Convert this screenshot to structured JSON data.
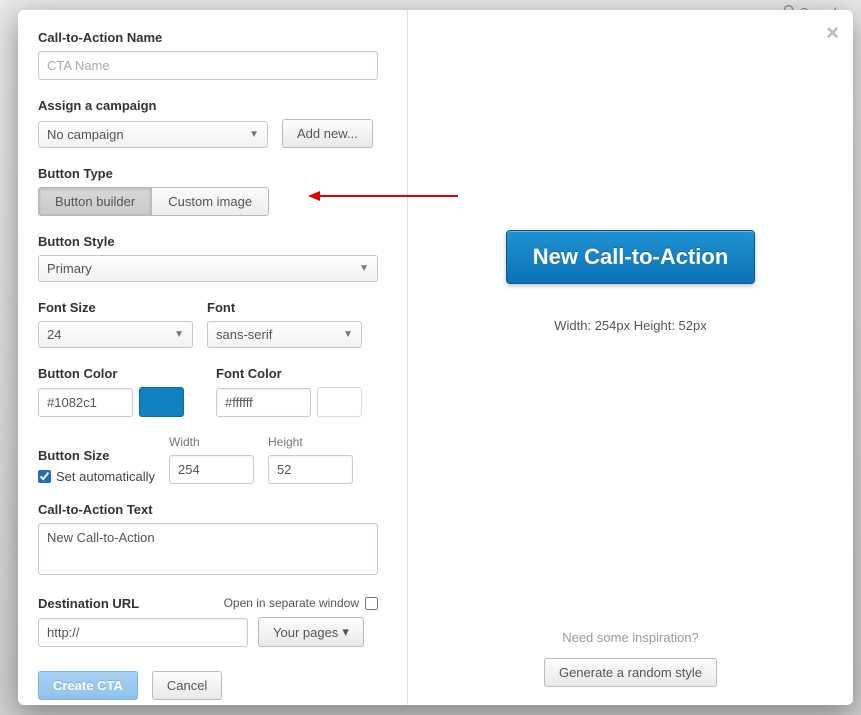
{
  "bg": {
    "search_placeholder": "Search"
  },
  "modal": {
    "cta_name_label": "Call-to-Action Name",
    "cta_name_placeholder": "CTA Name",
    "campaign_label": "Assign a campaign",
    "campaign_value": "No campaign",
    "add_new_label": "Add new...",
    "button_type_label": "Button Type",
    "seg_builder": "Button builder",
    "seg_custom": "Custom image",
    "button_style_label": "Button Style",
    "button_style_value": "Primary",
    "font_size_label": "Font Size",
    "font_size_value": "24",
    "font_label": "Font",
    "font_value": "sans-serif",
    "button_color_label": "Button Color",
    "button_color_value": "#1082c1",
    "button_color_hex": "#1082c1",
    "font_color_label": "Font Color",
    "font_color_value": "#ffffff",
    "font_color_hex": "#ffffff",
    "button_size_label": "Button Size",
    "set_auto_label": "Set automatically",
    "width_label": "Width",
    "width_value": "254",
    "height_label": "Height",
    "height_value": "52",
    "cta_text_label": "Call-to-Action Text",
    "cta_text_value": "New Call-to-Action",
    "dest_url_label": "Destination URL",
    "open_window_label": "Open in separate window",
    "dest_url_value": "http://",
    "your_pages_label": "Your pages",
    "create_cta_label": "Create CTA",
    "cancel_label": "Cancel"
  },
  "preview": {
    "button_text": "New Call-to-Action",
    "dimensions": "Width: 254px Height: 52px",
    "inspiration": "Need some inspiration?",
    "generate_label": "Generate a random style"
  }
}
